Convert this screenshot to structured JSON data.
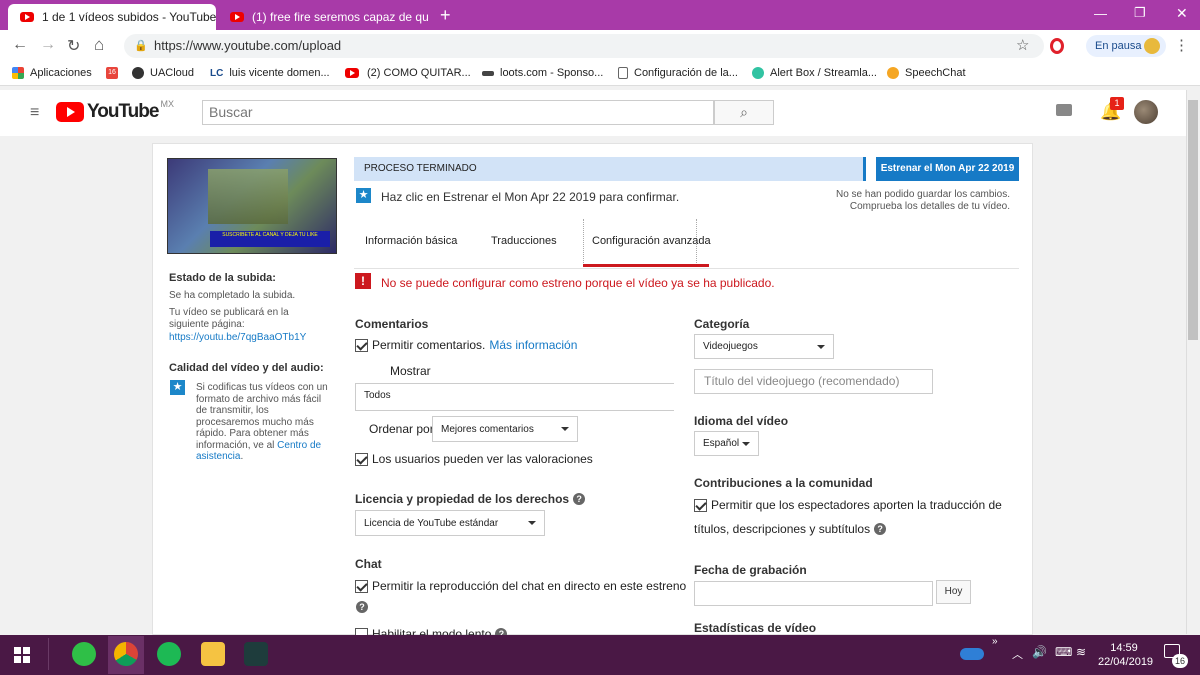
{
  "browser": {
    "tabs": [
      {
        "title": "1 de 1 vídeos subidos - YouTube"
      },
      {
        "title": "(1) free fire seremos capaz de qu"
      }
    ],
    "url": "https://www.youtube.com/upload",
    "profile_label": "En pausa",
    "bookmarks": [
      {
        "label": "Aplicaciones"
      },
      {
        "label": ""
      },
      {
        "label": "UACloud"
      },
      {
        "label": "luis vicente domen..."
      },
      {
        "label": "(2) COMO QUITAR..."
      },
      {
        "label": "loots.com - Sponso..."
      },
      {
        "label": "Configuración de la..."
      },
      {
        "label": "Alert Box / Streamla..."
      },
      {
        "label": "SpeechChat"
      }
    ]
  },
  "youtube": {
    "logo": "YouTube",
    "region": "MX",
    "search_placeholder": "Buscar",
    "notification_count": "1"
  },
  "upload": {
    "status_banner": "PROCESO TERMINADO",
    "premiere_button": "Estrenar el Mon Apr 22 2019",
    "confirm_text": "Haz clic en Estrenar el Mon Apr 22 2019 para confirmar.",
    "save_error_line1": "No se han podido guardar los cambios.",
    "save_error_line2": "Comprueba los detalles de tu vídeo.",
    "tabs": [
      "Información básica",
      "Traducciones",
      "Configuración avanzada"
    ],
    "error_message": "No se puede configurar como estreno porque el vídeo ya se ha publicado.",
    "thumbnail_caption": "SUSCRIBETE AL CANAL Y DEJA TU LIKE"
  },
  "sidebar": {
    "upload_status_title": "Estado de la subida:",
    "upload_status_text": "Se ha completado la subida.",
    "publish_text": "Tu vídeo se publicará en la siguiente página:",
    "video_link": "https://youtu.be/7qgBaaOTb1Y",
    "quality_title": "Calidad del vídeo y del audio:",
    "quality_text": "Si codificas tus vídeos con un formato de archivo más fácil de transmitir, los procesaremos mucho más rápido. Para obtener más información, ve al",
    "help_center_link": "Centro de asistencia",
    "help_center_end": "."
  },
  "left_col": {
    "comments_title": "Comentarios",
    "allow_comments": "Permitir comentarios.",
    "more_info": "Más información",
    "show_label": "Mostrar",
    "show_value": "Todos",
    "order_label": "Ordenar por",
    "order_value": "Mejores comentarios",
    "ratings_label": "Los usuarios pueden ver las valoraciones",
    "license_title": "Licencia y propiedad de los derechos",
    "license_value": "Licencia de YouTube estándar",
    "chat_title": "Chat",
    "chat_replay": "Permitir la reproducción del chat en directo en este estreno",
    "slow_mode": "Habilitar el modo lento"
  },
  "right_col": {
    "category_title": "Categoría",
    "category_value": "Videojuegos",
    "game_title_placeholder": "Título del videojuego (recomendado)",
    "language_title": "Idioma del vídeo",
    "language_value": "Español",
    "community_title": "Contribuciones a la comunidad",
    "community_option_line1": "Permitir que los espectadores aporten la traducción de",
    "community_option_line2": "títulos, descripciones y subtítulos",
    "recording_date_title": "Fecha de grabación",
    "today_button": "Hoy",
    "video_stats_title": "Estadísticas de vídeo"
  },
  "taskbar": {
    "time": "14:59",
    "date": "22/04/2019",
    "notif_count": "16"
  },
  "colors": {
    "tabstrip": "#a83aa8",
    "taskbar": "#4a1845",
    "youtube_red": "#ff0000",
    "banner_blue": "#d2e3f7",
    "primary_button": "#167ac6",
    "error_red": "#cc181e"
  }
}
